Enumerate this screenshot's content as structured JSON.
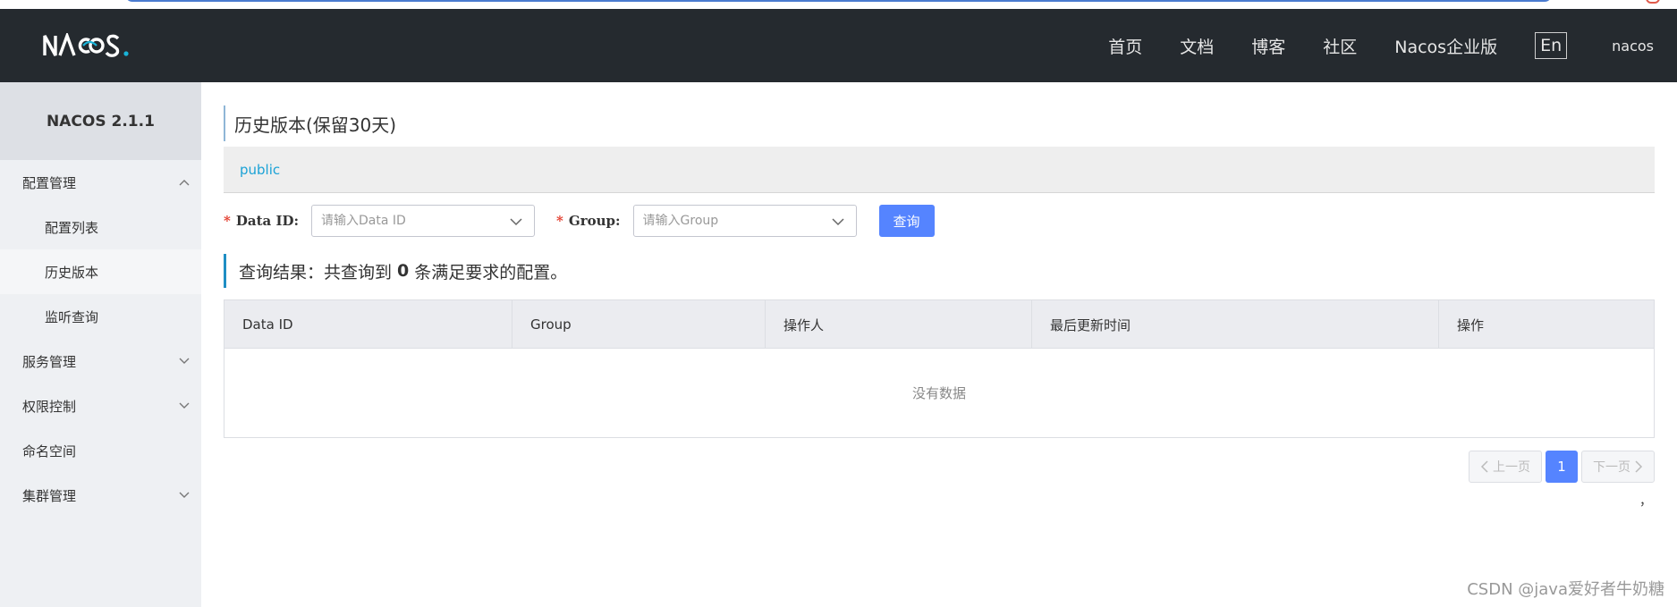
{
  "header": {
    "logo_text": "NACOS.",
    "nav": [
      "首页",
      "文档",
      "博客",
      "社区",
      "Nacos企业版"
    ],
    "lang": "En",
    "user": "nacos"
  },
  "sidebar": {
    "version": "NACOS 2.1.1",
    "items": [
      {
        "label": "配置管理",
        "level": 1,
        "expanded": true
      },
      {
        "label": "配置列表",
        "level": 2
      },
      {
        "label": "历史版本",
        "level": 2,
        "active": true
      },
      {
        "label": "监听查询",
        "level": 2
      },
      {
        "label": "服务管理",
        "level": 1,
        "expanded": false
      },
      {
        "label": "权限控制",
        "level": 1,
        "expanded": false
      },
      {
        "label": "命名空间",
        "level": 1
      },
      {
        "label": "集群管理",
        "level": 1,
        "expanded": false
      }
    ]
  },
  "main": {
    "title": "历史版本(保留30天)",
    "namespace": "public",
    "search": {
      "data_id_label": "Data ID:",
      "data_id_placeholder": "请输入Data ID",
      "group_label": "Group:",
      "group_placeholder": "请输入Group",
      "query_label": "查询"
    },
    "result": {
      "prefix": "查询结果：共查询到",
      "count": "0",
      "suffix": "条满足要求的配置。"
    },
    "table": {
      "columns": [
        "Data ID",
        "Group",
        "操作人",
        "最后更新时间",
        "操作"
      ],
      "empty_text": "没有数据"
    },
    "pager": {
      "prev": "上一页",
      "current": "1",
      "next": "下一页"
    },
    "stray_mark": "，"
  },
  "watermark": "CSDN @java爱好者牛奶糖",
  "colors": {
    "header_bg": "#252a2f",
    "primary": "#5584ff",
    "link": "#1ba2d6",
    "sidebar_bg": "#eef0f3"
  }
}
